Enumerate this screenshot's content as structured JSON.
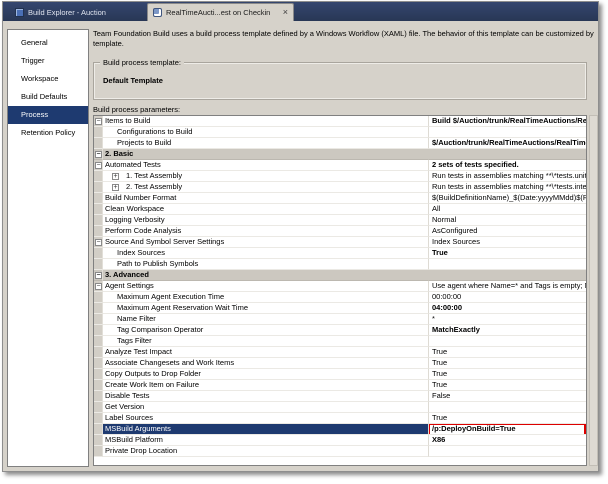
{
  "tabs": [
    {
      "label": "Build Explorer - Auction",
      "active": false
    },
    {
      "label": "RealTimeAucti...est on Checkin",
      "active": true,
      "close_glyph": "×"
    }
  ],
  "sidebar": {
    "items": [
      {
        "label": "General"
      },
      {
        "label": "Trigger"
      },
      {
        "label": "Workspace"
      },
      {
        "label": "Build Defaults"
      },
      {
        "label": "Process"
      },
      {
        "label": "Retention Policy"
      }
    ],
    "selected_index": 4
  },
  "description": {
    "line1": "Team Foundation Build uses a build process template defined by a Windows Workflow (XAML) file. The behavior of this template can be customized by setting the b",
    "line2": "template."
  },
  "template_box": {
    "label": "Build process template:",
    "value": "Default Template"
  },
  "parameters_label": "Build process parameters:",
  "grid": {
    "rows": [
      {
        "label": "Items to Build",
        "value": "Build $/Auction/trunk/RealTimeAuctions/Rea",
        "indent": 0,
        "box": "minus",
        "value_bold": true
      },
      {
        "label": "Configurations to Build",
        "value": "",
        "indent": 1
      },
      {
        "label": "Projects to Build",
        "value": "$/Auction/trunk/RealTimeAuctions/RealTime",
        "indent": 1,
        "value_bold": true
      },
      {
        "label": "2. Basic",
        "value": "",
        "indent": 0,
        "box": "minus",
        "category": true
      },
      {
        "label": "Automated Tests",
        "value": "2 sets of tests specified.",
        "indent": 0,
        "box": "minus",
        "value_bold": true
      },
      {
        "label": "1. Test Assembly",
        "value": "Run tests in assemblies matching **\\*tests.unit*.dll u",
        "indent": 1,
        "box": "plus"
      },
      {
        "label": "2. Test Assembly",
        "value": "Run tests in assemblies matching **\\*tests.integration",
        "indent": 1,
        "box": "plus"
      },
      {
        "label": "Build Number Format",
        "value": "$(BuildDefinitionName)_$(Date:yyyyMMdd)$(Rev:.r)",
        "indent": 0
      },
      {
        "label": "Clean Workspace",
        "value": "All",
        "indent": 0
      },
      {
        "label": "Logging Verbosity",
        "value": "Normal",
        "indent": 0
      },
      {
        "label": "Perform Code Analysis",
        "value": "AsConfigured",
        "indent": 0
      },
      {
        "label": "Source And Symbol Server Settings",
        "value": "Index Sources",
        "indent": 0,
        "box": "minus"
      },
      {
        "label": "Index Sources",
        "value": "True",
        "indent": 1,
        "value_bold": true
      },
      {
        "label": "Path to Publish Symbols",
        "value": "",
        "indent": 1
      },
      {
        "label": "3. Advanced",
        "value": "",
        "indent": 0,
        "box": "minus",
        "category": true
      },
      {
        "label": "Agent Settings",
        "value": "Use agent where Name=* and Tags is empty; Max W",
        "indent": 0,
        "box": "minus"
      },
      {
        "label": "Maximum Agent Execution Time",
        "value": "00:00:00",
        "indent": 1
      },
      {
        "label": "Maximum Agent Reservation Wait Time",
        "value": "04:00:00",
        "indent": 1,
        "value_bold": true
      },
      {
        "label": "Name Filter",
        "value": "*",
        "indent": 1
      },
      {
        "label": "Tag Comparison Operator",
        "value": "MatchExactly",
        "indent": 1,
        "value_bold": true
      },
      {
        "label": "Tags Filter",
        "value": "",
        "indent": 1
      },
      {
        "label": "Analyze Test Impact",
        "value": "True",
        "indent": 0
      },
      {
        "label": "Associate Changesets and Work Items",
        "value": "True",
        "indent": 0
      },
      {
        "label": "Copy Outputs to Drop Folder",
        "value": "True",
        "indent": 0
      },
      {
        "label": "Create Work Item on Failure",
        "value": "True",
        "indent": 0
      },
      {
        "label": "Disable Tests",
        "value": "False",
        "indent": 0
      },
      {
        "label": "Get Version",
        "value": "",
        "indent": 0
      },
      {
        "label": "Label Sources",
        "value": "True",
        "indent": 0
      },
      {
        "label": "MSBuild Arguments",
        "value": "/p:DeployOnBuild=True",
        "indent": 0,
        "value_bold": true,
        "selected": true,
        "red_box": true
      },
      {
        "label": "MSBuild Platform",
        "value": "X86",
        "indent": 0,
        "value_bold": true
      },
      {
        "label": "Private Drop Location",
        "value": "",
        "indent": 0
      }
    ]
  },
  "colors": {
    "tabbar": "#2c3a60",
    "selection_navy": "#1e3a70",
    "window_gray": "#d6d2ca",
    "category_gray": "#ccc8c0",
    "highlight_red": "#dd0000"
  }
}
